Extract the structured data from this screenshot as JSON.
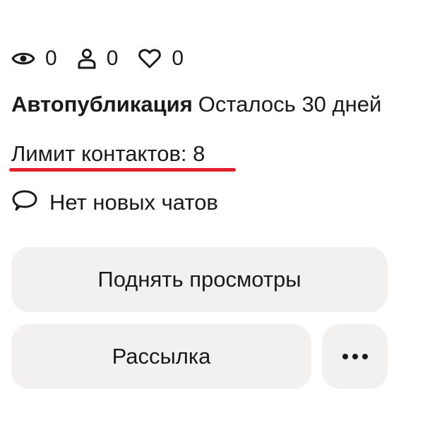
{
  "stats": {
    "views": {
      "icon": "eye-icon",
      "value": "0"
    },
    "contacts": {
      "icon": "person-icon",
      "value": "0"
    },
    "favorites": {
      "icon": "heart-icon",
      "value": "0"
    }
  },
  "autopublication": {
    "label": "Автопубликация",
    "remaining": "Осталось 30 дней"
  },
  "contact_limit": {
    "text": "Лимит контактов: 8",
    "underline_color": "#e0202c"
  },
  "chats": {
    "icon": "chat-bubble-icon",
    "label": "Нет новых чатов"
  },
  "buttons": {
    "raise_views": "Поднять просмотры",
    "mailing": "Рассылка",
    "more_icon": "more-dots-icon"
  },
  "colors": {
    "button_bg": "#f2f1f0",
    "text": "#1a1a1a",
    "accent_red": "#e0202c"
  }
}
